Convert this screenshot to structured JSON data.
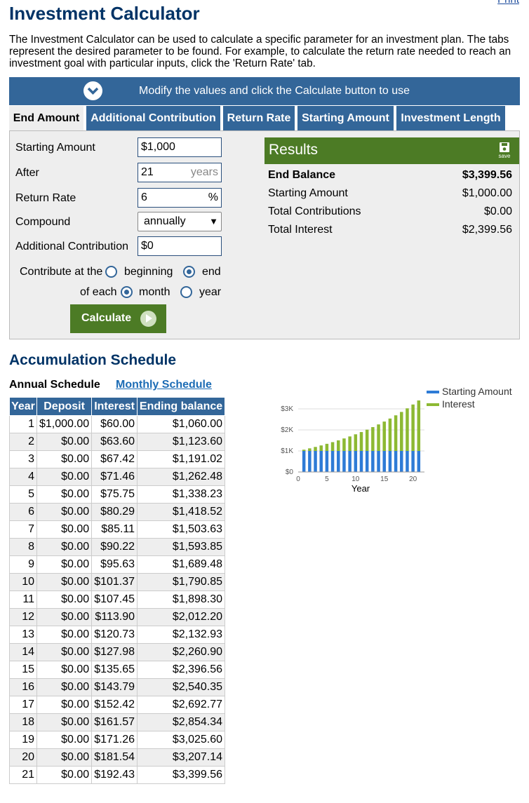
{
  "print_label": "Print",
  "title": "Investment Calculator",
  "intro": "The Investment Calculator can be used to calculate a specific parameter for an investment plan. The tabs represent the desired parameter to be found. For example, to calculate the return rate needed to reach an investment goal with particular inputs, click the 'Return Rate' tab.",
  "banner_text": "Modify the values and click the Calculate button to use",
  "tabs": [
    "End Amount",
    "Additional Contribution",
    "Return Rate",
    "Starting Amount",
    "Investment Length"
  ],
  "active_tab": "End Amount",
  "form": {
    "starting_amount_label": "Starting Amount",
    "starting_amount_value": "$1,000",
    "after_label": "After",
    "after_value": "21",
    "after_unit": "years",
    "return_rate_label": "Return Rate",
    "return_rate_value": "6",
    "return_rate_unit": "%",
    "compound_label": "Compound",
    "compound_value": "annually",
    "additional_label": "Additional Contribution",
    "additional_value": "$0",
    "contribute_at_label": "Contribute at the",
    "beginning_label": "beginning",
    "end_label": "end",
    "of_each_label": "of each",
    "month_label": "month",
    "year_label": "year",
    "calculate_label": "Calculate"
  },
  "results": {
    "title": "Results",
    "save_label": "save",
    "rows": [
      {
        "label": "End Balance",
        "value": "$3,399.56"
      },
      {
        "label": "Starting Amount",
        "value": "$1,000.00"
      },
      {
        "label": "Total Contributions",
        "value": "$0.00"
      },
      {
        "label": "Total Interest",
        "value": "$2,399.56"
      }
    ]
  },
  "schedule": {
    "heading": "Accumulation Schedule",
    "annual_label": "Annual Schedule",
    "monthly_label": "Monthly Schedule",
    "columns": [
      "Year",
      "Deposit",
      "Interest",
      "Ending balance"
    ],
    "rows": [
      [
        "1",
        "$1,000.00",
        "$60.00",
        "$1,060.00"
      ],
      [
        "2",
        "$0.00",
        "$63.60",
        "$1,123.60"
      ],
      [
        "3",
        "$0.00",
        "$67.42",
        "$1,191.02"
      ],
      [
        "4",
        "$0.00",
        "$71.46",
        "$1,262.48"
      ],
      [
        "5",
        "$0.00",
        "$75.75",
        "$1,338.23"
      ],
      [
        "6",
        "$0.00",
        "$80.29",
        "$1,418.52"
      ],
      [
        "7",
        "$0.00",
        "$85.11",
        "$1,503.63"
      ],
      [
        "8",
        "$0.00",
        "$90.22",
        "$1,593.85"
      ],
      [
        "9",
        "$0.00",
        "$95.63",
        "$1,689.48"
      ],
      [
        "10",
        "$0.00",
        "$101.37",
        "$1,790.85"
      ],
      [
        "11",
        "$0.00",
        "$107.45",
        "$1,898.30"
      ],
      [
        "12",
        "$0.00",
        "$113.90",
        "$2,012.20"
      ],
      [
        "13",
        "$0.00",
        "$120.73",
        "$2,132.93"
      ],
      [
        "14",
        "$0.00",
        "$127.98",
        "$2,260.90"
      ],
      [
        "15",
        "$0.00",
        "$135.65",
        "$2,396.56"
      ],
      [
        "16",
        "$0.00",
        "$143.79",
        "$2,540.35"
      ],
      [
        "17",
        "$0.00",
        "$152.42",
        "$2,692.77"
      ],
      [
        "18",
        "$0.00",
        "$161.57",
        "$2,854.34"
      ],
      [
        "19",
        "$0.00",
        "$171.26",
        "$3,025.60"
      ],
      [
        "20",
        "$0.00",
        "$181.54",
        "$3,207.14"
      ],
      [
        "21",
        "$0.00",
        "$192.43",
        "$3,399.56"
      ]
    ]
  },
  "colors": {
    "header_blue": "#336699",
    "result_green": "#4c7b25",
    "starting_amount_series": "#2e7bd6",
    "interest_series": "#8db933"
  },
  "icons": [
    "chevron-down-circle-icon",
    "save-disk-icon",
    "play-arrow-icon"
  ],
  "chart_data": {
    "type": "bar",
    "stacked": true,
    "xlabel": "Year",
    "ylabel": "",
    "x": [
      1,
      2,
      3,
      4,
      5,
      6,
      7,
      8,
      9,
      10,
      11,
      12,
      13,
      14,
      15,
      16,
      17,
      18,
      19,
      20,
      21
    ],
    "xticks": [
      "0",
      "5",
      "10",
      "15",
      "20"
    ],
    "yticks": [
      "$0",
      "$1K",
      "$2K",
      "$3K"
    ],
    "ylim": [
      0,
      3500
    ],
    "xlim": [
      0,
      22
    ],
    "legend_position": "top-right",
    "series": [
      {
        "name": "Starting Amount",
        "color": "#2e7bd6",
        "values": [
          1000,
          1000,
          1000,
          1000,
          1000,
          1000,
          1000,
          1000,
          1000,
          1000,
          1000,
          1000,
          1000,
          1000,
          1000,
          1000,
          1000,
          1000,
          1000,
          1000,
          1000
        ]
      },
      {
        "name": "Interest",
        "color": "#8db933",
        "values": [
          60.0,
          123.6,
          191.02,
          262.48,
          338.23,
          418.52,
          503.63,
          593.85,
          689.48,
          790.85,
          898.3,
          1012.2,
          1132.93,
          1260.9,
          1396.56,
          1540.35,
          1692.77,
          1854.34,
          2025.6,
          2207.14,
          2399.56
        ]
      }
    ]
  }
}
